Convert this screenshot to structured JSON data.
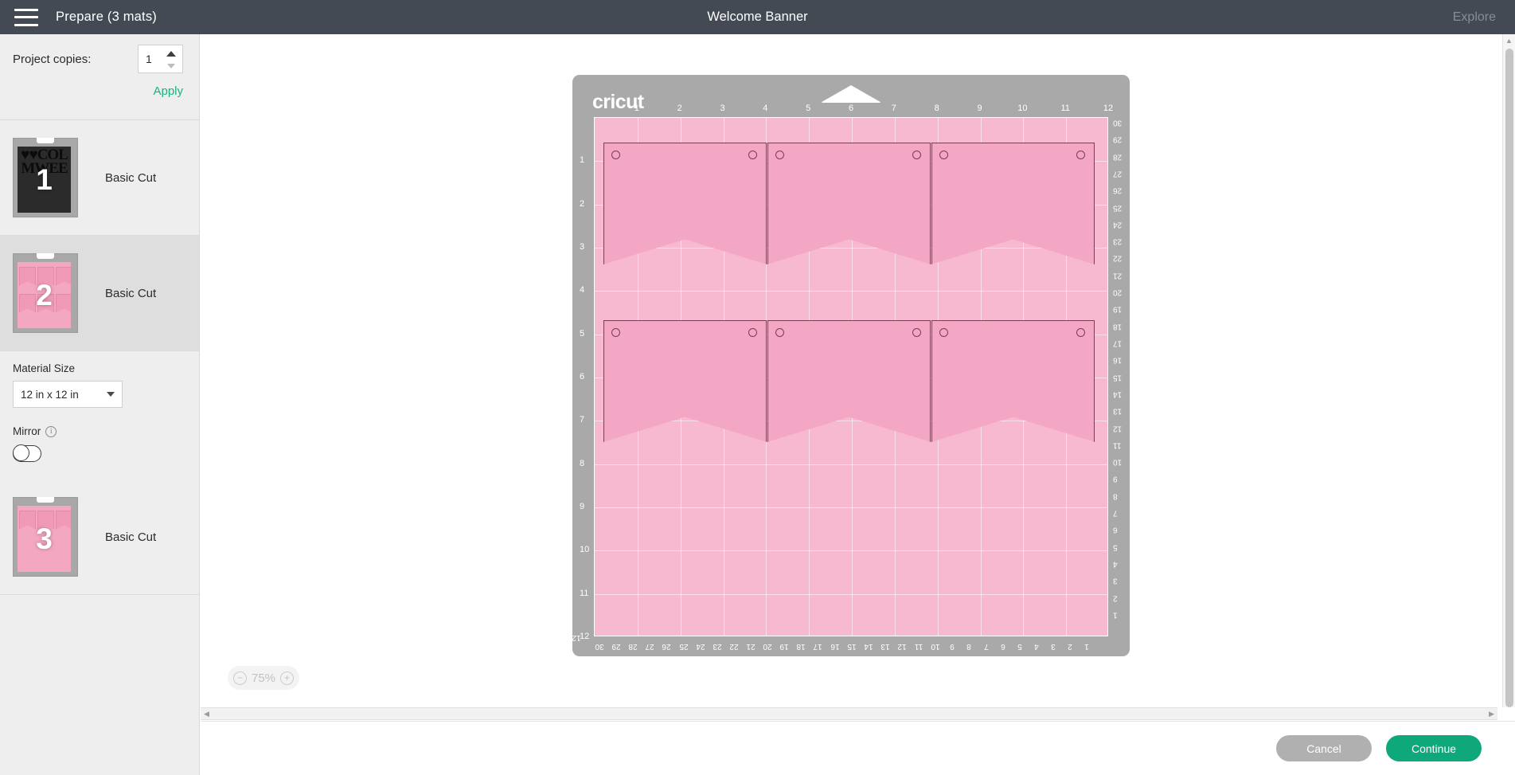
{
  "header": {
    "menu_icon": "hamburger-menu-icon",
    "title": "Prepare (3 mats)",
    "project_name": "Welcome Banner",
    "explore_label": "Explore"
  },
  "sidebar": {
    "copies_label": "Project copies:",
    "copies_value": "1",
    "apply_label": "Apply",
    "mats": [
      {
        "number": "1",
        "label": "Basic Cut",
        "material_color": "#2b2b2b",
        "selected": false,
        "letters_line1": "♥♥COL",
        "letters_line2": "MWEE"
      },
      {
        "number": "2",
        "label": "Basic Cut",
        "material_color": "#f4a7c0",
        "selected": true
      },
      {
        "number": "3",
        "label": "Basic Cut",
        "material_color": "#f4a7c0",
        "selected": false
      }
    ],
    "material_size_label": "Material Size",
    "material_size_value": "12 in x 12 in",
    "mirror_label": "Mirror",
    "mirror_info_icon": "info-icon",
    "mirror_enabled": false
  },
  "canvas": {
    "mat_brand": "cricut",
    "mat_color": "#a9a9a9",
    "material_color": "#f7b9cf",
    "shape_fill": "#f4a7c4",
    "shape_stroke": "#7e3b55",
    "ruler_top_inches": [
      "1",
      "2",
      "3",
      "4",
      "5",
      "6",
      "7",
      "8",
      "9",
      "10",
      "11",
      "12"
    ],
    "ruler_left_inches": [
      "1",
      "2",
      "3",
      "4",
      "5",
      "6",
      "7",
      "8",
      "9",
      "10",
      "11",
      "12"
    ],
    "ruler_right_cm": [
      "30",
      "29",
      "28",
      "27",
      "26",
      "25",
      "24",
      "23",
      "22",
      "21",
      "20",
      "19",
      "18",
      "17",
      "16",
      "15",
      "14",
      "13",
      "12",
      "11",
      "10",
      "9",
      "8",
      "7",
      "6",
      "5",
      "4",
      "3",
      "2",
      "1"
    ],
    "ruler_bottom_cm": [
      "30",
      "29",
      "28",
      "27",
      "26",
      "25",
      "24",
      "23",
      "22",
      "21",
      "20",
      "19",
      "18",
      "17",
      "16",
      "15",
      "14",
      "13",
      "12",
      "11",
      "10",
      "9",
      "8",
      "7",
      "6",
      "5",
      "4",
      "3",
      "2",
      "1"
    ],
    "shapes": [
      {
        "name": "pennant-1",
        "row": 1,
        "col": 1
      },
      {
        "name": "pennant-2",
        "row": 1,
        "col": 2
      },
      {
        "name": "pennant-3",
        "row": 1,
        "col": 3
      },
      {
        "name": "pennant-4",
        "row": 2,
        "col": 1
      },
      {
        "name": "pennant-5",
        "row": 2,
        "col": 2
      },
      {
        "name": "pennant-6",
        "row": 2,
        "col": 3
      }
    ],
    "zoom_level": "75%",
    "zoom_out_icon": "minus-circle-icon",
    "zoom_in_icon": "plus-circle-icon"
  },
  "footer": {
    "cancel_label": "Cancel",
    "continue_label": "Continue",
    "cancel_color": "#b0b0b0",
    "continue_color": "#0fa87a"
  }
}
